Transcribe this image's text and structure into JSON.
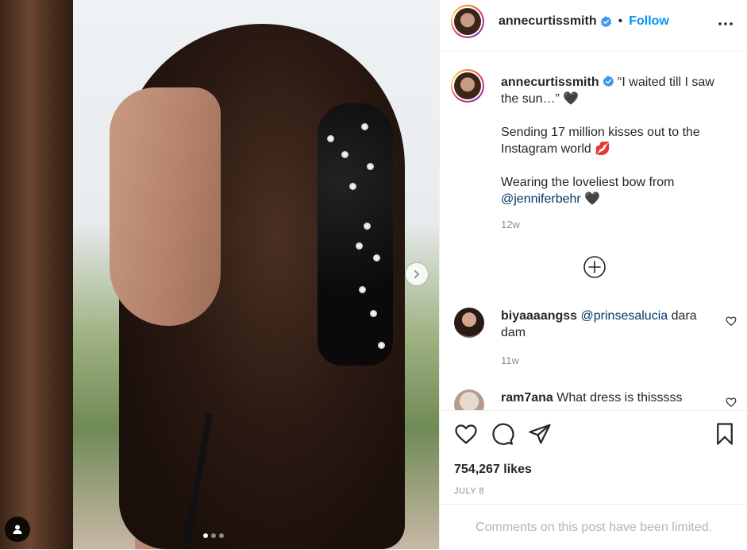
{
  "header": {
    "username": "annecurtissmith",
    "separator": "•",
    "follow_label": "Follow"
  },
  "caption": {
    "username": "annecurtissmith",
    "line1": "“I waited till I saw the sun…” 🖤",
    "line2": "Sending 17 million kisses out to the Instagram world 💋",
    "line3_prefix": "Wearing the loveliest bow from ",
    "line3_mention": "@jenniferbehr",
    "line3_suffix": " 🖤",
    "time": "12w"
  },
  "comments": [
    {
      "username": "biyaaaangss",
      "mention": "@prinsesalucia",
      "text": " dara dam",
      "time": "11w"
    },
    {
      "username": "ram7ana",
      "text": " What dress is thisssss"
    }
  ],
  "likes": "754,267 likes",
  "date": "JULY 8",
  "limited_notice": "Comments on this post have been limited.",
  "carousel": {
    "current": 1,
    "total": 3
  },
  "icons": [
    "verified-badge-icon",
    "more-options-icon",
    "load-more-icon",
    "heart-icon",
    "comment-icon",
    "share-icon",
    "bookmark-icon",
    "chevron-right-icon",
    "user-tag-icon"
  ],
  "colors": {
    "link": "#0095f6",
    "mention": "#00376b",
    "muted": "#8e8e8e",
    "verified": "#3897f0"
  }
}
